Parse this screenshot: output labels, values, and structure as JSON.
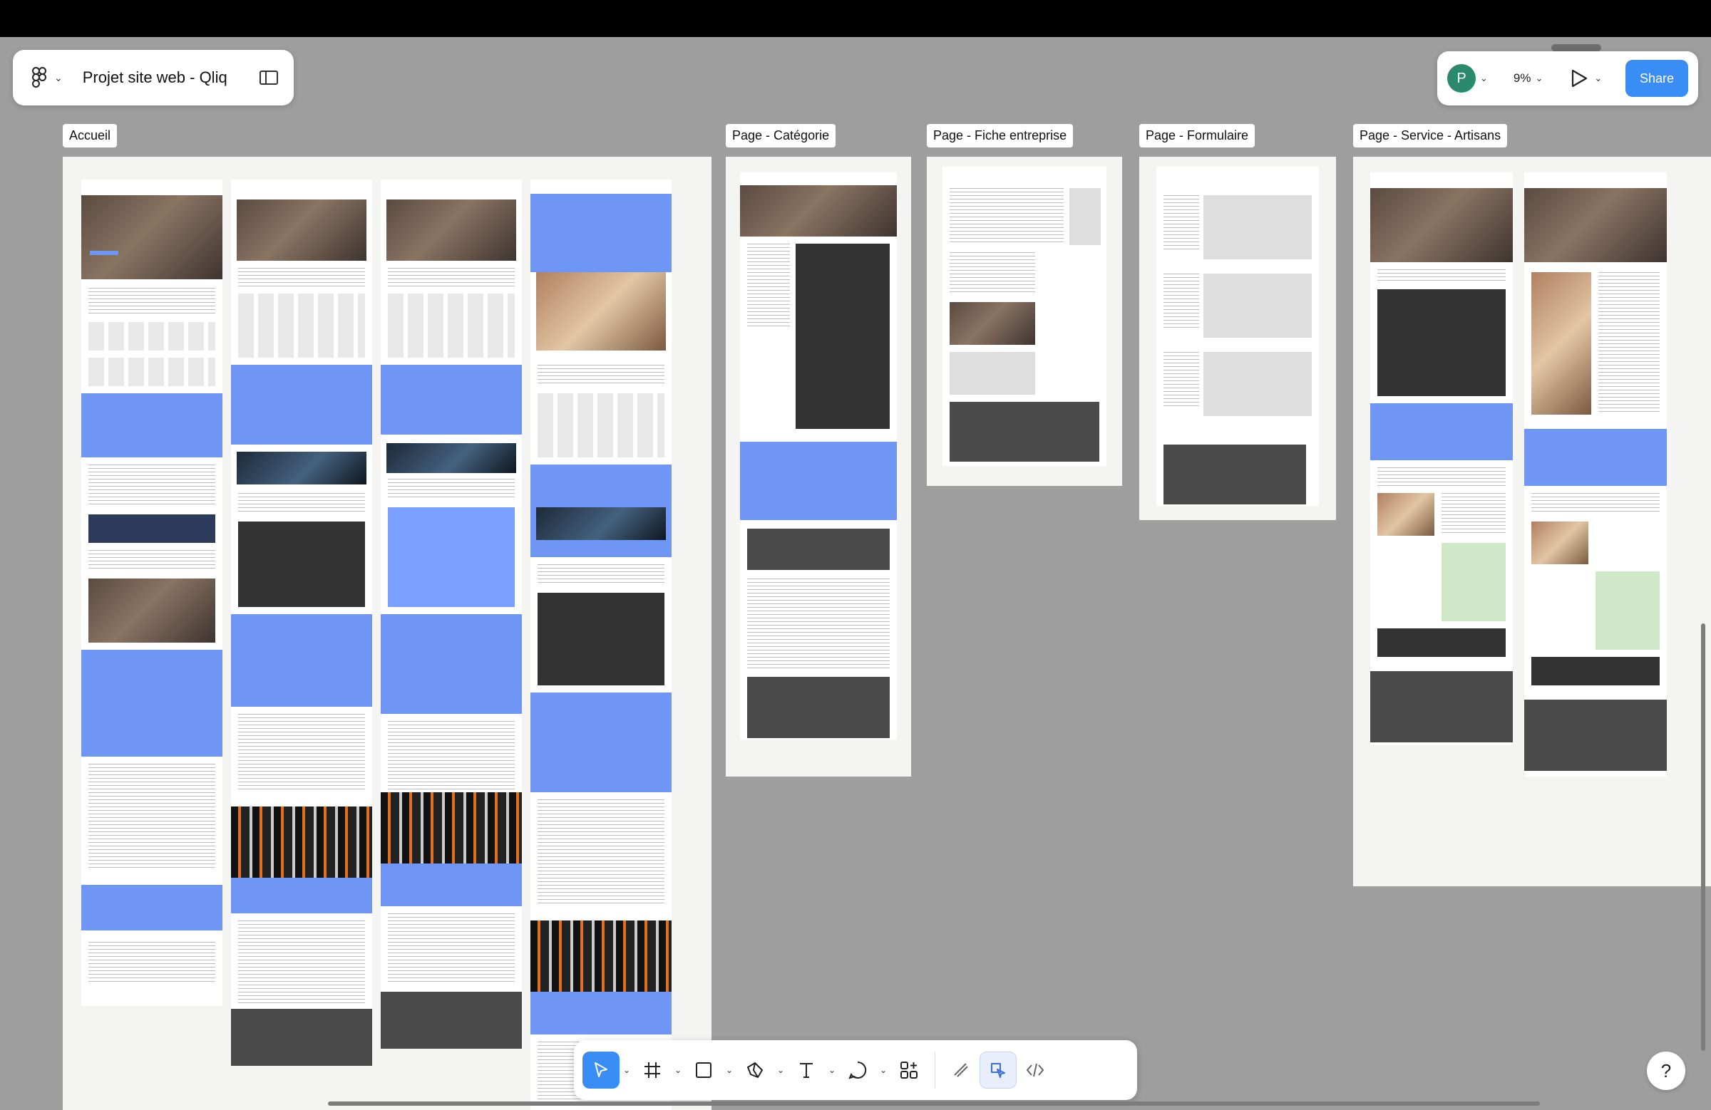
{
  "app": {
    "file_title": "Projet site web - Qliq",
    "zoom": "9%",
    "share_label": "Share",
    "avatar_initial": "P",
    "help_label": "?"
  },
  "frames": [
    {
      "label": "Accueil"
    },
    {
      "label": "Page - Catégorie"
    },
    {
      "label": "Page - Fiche entreprise"
    },
    {
      "label": "Page - Formulaire"
    },
    {
      "label": "Page - Service - Artisans"
    }
  ],
  "toolbar": {
    "tools": [
      "move-tool",
      "frame-tool",
      "rectangle-tool",
      "pen-tool",
      "text-tool",
      "comment-tool",
      "actions-tool",
      "draw-mode",
      "design-mode",
      "dev-mode"
    ],
    "active_tool": "move-tool"
  },
  "colors": {
    "accent": "#3a8df5",
    "canvas": "#9e9e9e",
    "page_blue": "#6f95f5",
    "avatar": "#2a8a6b"
  }
}
